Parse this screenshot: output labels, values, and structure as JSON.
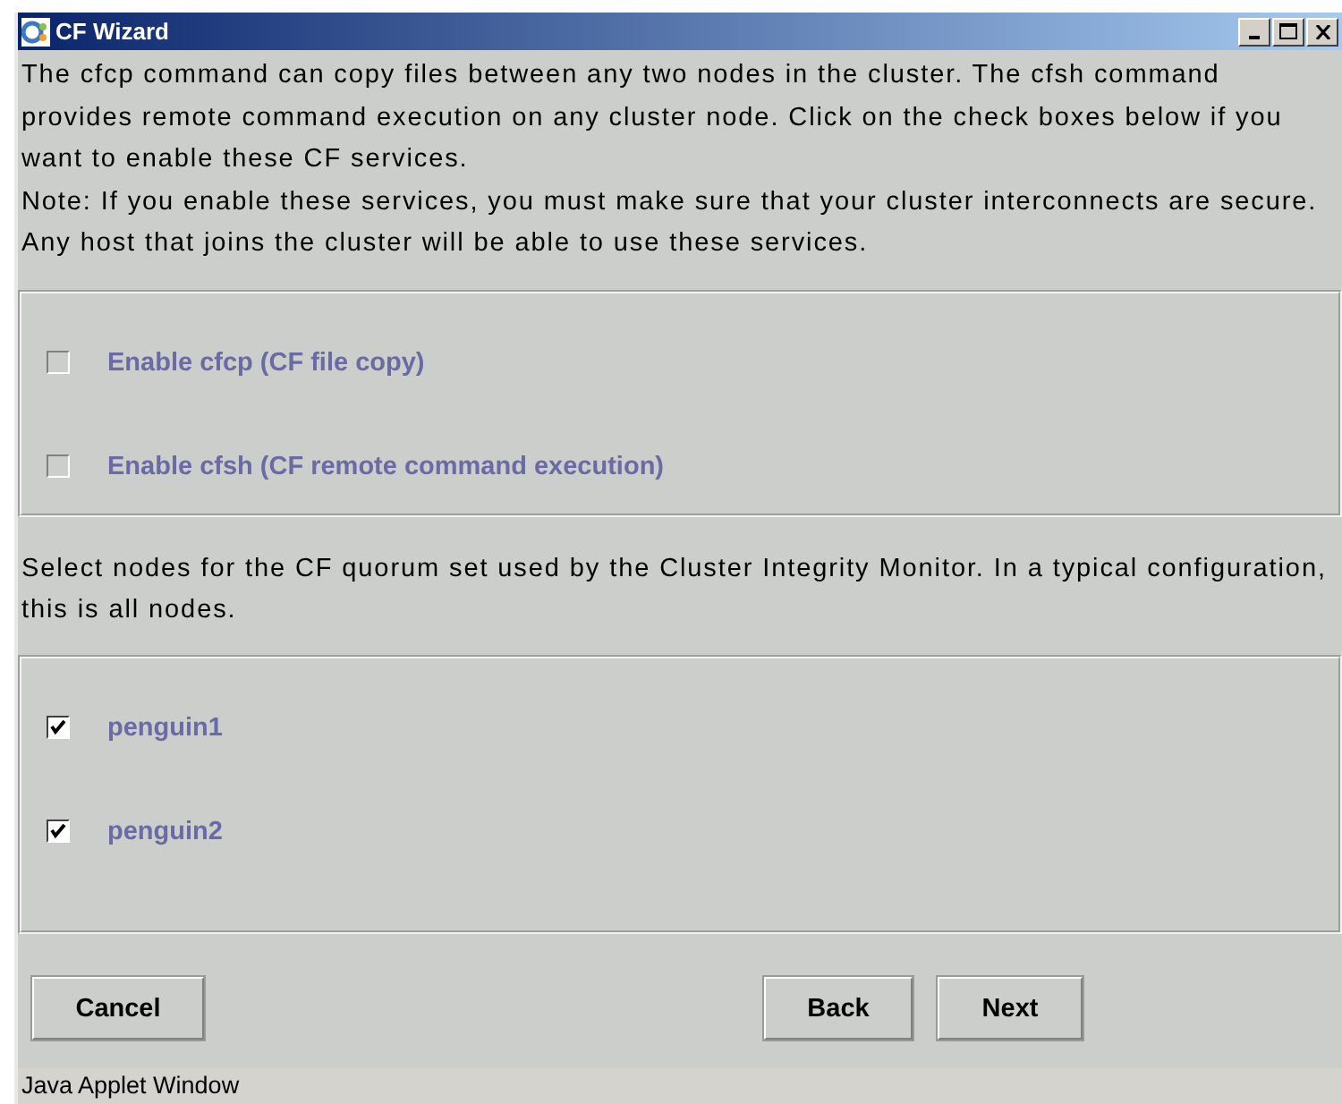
{
  "window": {
    "title": "CF Wizard"
  },
  "intro": [
    "The cfcp command can copy files between any two nodes in the cluster.  The cfsh command provides remote command execution on any cluster node.  Click on the check boxes below if you want to enable these CF services.",
    "Note: If you enable these services, you must make sure that your cluster interconnects are secure. Any host that joins the cluster will be able to use these services."
  ],
  "services": [
    {
      "label": "Enable cfcp (CF file copy)",
      "checked": false
    },
    {
      "label": "Enable cfsh (CF remote command execution)",
      "checked": false
    }
  ],
  "quorum_text": "Select nodes for the CF quorum set used by the Cluster Integrity Monitor.  In a typical configuration, this is all nodes.",
  "nodes": [
    {
      "label": "penguin1",
      "checked": true
    },
    {
      "label": "penguin2",
      "checked": true
    }
  ],
  "buttons": {
    "left": [
      "Cancel"
    ],
    "right": [
      "Back",
      "Next"
    ]
  },
  "status_bar": "Java Applet Window"
}
